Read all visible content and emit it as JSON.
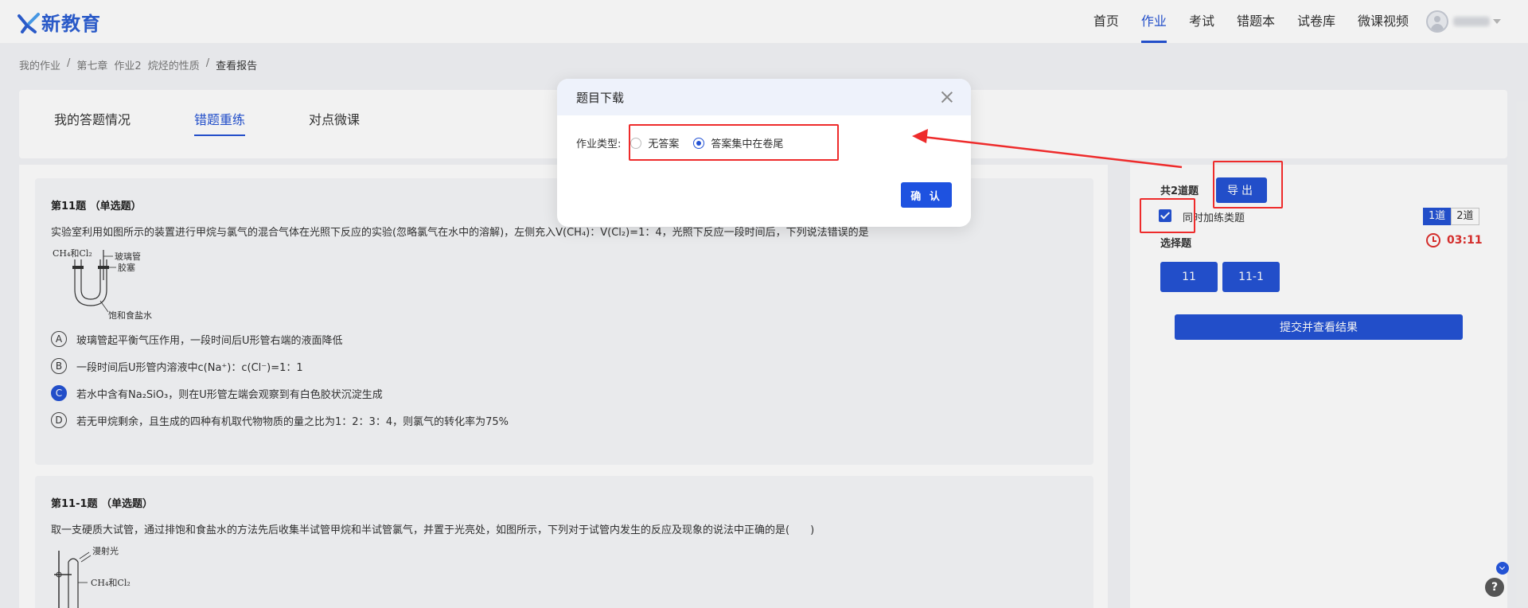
{
  "header": {
    "logo_text": "新教育",
    "nav": [
      "首页",
      "作业",
      "考试",
      "错题本",
      "试卷库",
      "微课视频"
    ],
    "active_nav": 1
  },
  "breadcrumb": [
    "我的作业",
    "/",
    "第七章",
    "作业2",
    "烷烃的性质",
    "/",
    "查看报告"
  ],
  "tabs": [
    "我的答题情况",
    "错题重练",
    "对点微课"
  ],
  "active_tab": 1,
  "questions": [
    {
      "title": "第11题 （单选题）",
      "text": "实验室利用如图所示的装置进行甲烷与氯气的混合气体在光照下反应的实验(忽略氯气在水中的溶解)，左侧充入V(CH₄)：V(Cl₂)=1：4，光照下反应一段时间后，下列说法错误的是",
      "figure_labels": [
        "CH₄和Cl₂",
        "玻璃管",
        "胶塞",
        "饱和食盐水"
      ],
      "options": [
        {
          "letter": "A",
          "text": "玻璃管起平衡气压作用，一段时间后U形管右端的液面降低"
        },
        {
          "letter": "B",
          "text": "一段时间后U形管内溶液中c(Na⁺)：c(Cl⁻)=1：1"
        },
        {
          "letter": "C",
          "text": "若水中含有Na₂SiO₃，则在U形管左端会观察到有白色胶状沉淀生成"
        },
        {
          "letter": "D",
          "text": "若无甲烷剩余，且生成的四种有机取代物物质的量之比为1：2：3：4，则氯气的转化率为75%"
        }
      ],
      "selected": 2
    },
    {
      "title": "第11-1题 （单选题）",
      "text": "取一支硬质大试管，通过排饱和食盐水的方法先后收集半试管甲烷和半试管氯气，并置于光亮处，如图所示，下列对于试管内发生的反应及现象的说法中正确的是(　　)",
      "figure_labels": [
        "漫射光",
        "CH₄和Cl₂"
      ]
    }
  ],
  "side": {
    "count_label": "共2道题",
    "export_label": "导出",
    "checkbox_label": "同时加练类题",
    "checked": true,
    "segments": [
      "1道",
      "2道"
    ],
    "active_segment": 0,
    "type_label": "选择题",
    "timer": "03:11",
    "question_buttons": [
      "11",
      "11-1"
    ],
    "submit_label": "提交并查看结果"
  },
  "modal": {
    "title": "题目下载",
    "field_label": "作业类型:",
    "options": [
      "无答案",
      "答案集中在卷尾"
    ],
    "selected": 1,
    "confirm_label": "确 认"
  },
  "colors": {
    "primary": "#2453d4",
    "annotation": "#ee2b2b",
    "timer": "#e0312f"
  },
  "help_label": "?"
}
